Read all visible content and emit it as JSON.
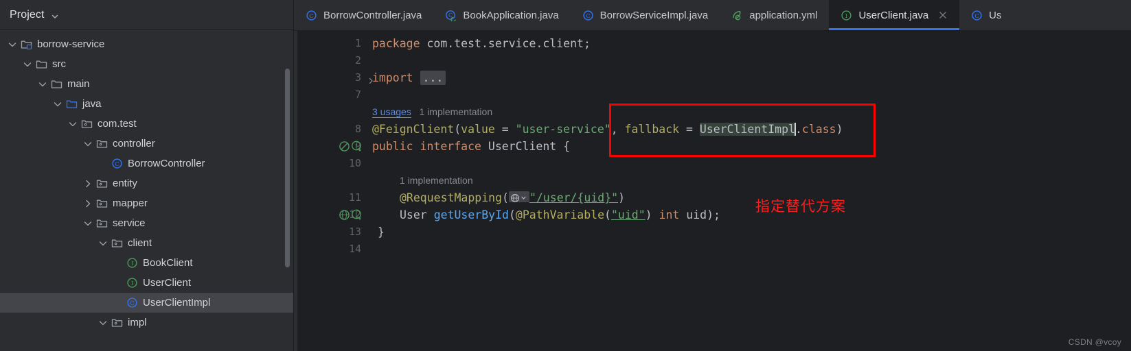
{
  "sidebar": {
    "title": "Project",
    "title_chevron_icon": "chevron-down-icon",
    "tree": [
      {
        "label": "borrow-service",
        "depth": 1,
        "twisty": "expanded",
        "icon": "module-folder-icon",
        "selected": false
      },
      {
        "label": "src",
        "depth": 2,
        "twisty": "expanded",
        "icon": "folder-icon",
        "selected": false
      },
      {
        "label": "main",
        "depth": 3,
        "twisty": "expanded",
        "icon": "folder-icon",
        "selected": false
      },
      {
        "label": "java",
        "depth": 4,
        "twisty": "expanded",
        "icon": "source-folder-icon",
        "selected": false
      },
      {
        "label": "com.test",
        "depth": 5,
        "twisty": "expanded",
        "icon": "package-icon",
        "selected": false
      },
      {
        "label": "controller",
        "depth": 6,
        "twisty": "expanded",
        "icon": "package-icon",
        "selected": false
      },
      {
        "label": "BorrowController",
        "depth": 7,
        "twisty": "none",
        "icon": "class-icon",
        "selected": false
      },
      {
        "label": "entity",
        "depth": 6,
        "twisty": "collapsed",
        "icon": "package-icon",
        "selected": false
      },
      {
        "label": "mapper",
        "depth": 6,
        "twisty": "collapsed",
        "icon": "package-icon",
        "selected": false
      },
      {
        "label": "service",
        "depth": 6,
        "twisty": "expanded",
        "icon": "package-icon",
        "selected": false
      },
      {
        "label": "client",
        "depth": 7,
        "twisty": "expanded",
        "icon": "package-icon",
        "selected": false
      },
      {
        "label": "BookClient",
        "depth": 8,
        "twisty": "none",
        "icon": "interface-icon",
        "selected": false
      },
      {
        "label": "UserClient",
        "depth": 8,
        "twisty": "none",
        "icon": "interface-icon",
        "selected": false
      },
      {
        "label": "UserClientImpl",
        "depth": 8,
        "twisty": "none",
        "icon": "class-icon",
        "selected": true
      },
      {
        "label": "impl",
        "depth": 7,
        "twisty": "expanded",
        "icon": "package-icon",
        "selected": false
      }
    ]
  },
  "tabs": [
    {
      "label": "BorrowController.java",
      "icon": "class-icon",
      "active": false,
      "closable": false
    },
    {
      "label": "BookApplication.java",
      "icon": "spring-class-icon",
      "active": false,
      "closable": false
    },
    {
      "label": "BorrowServiceImpl.java",
      "icon": "class-icon",
      "active": false,
      "closable": false
    },
    {
      "label": "application.yml",
      "icon": "spring-yaml-icon",
      "active": false,
      "closable": false
    },
    {
      "label": "UserClient.java",
      "icon": "interface-icon",
      "active": true,
      "closable": true
    },
    {
      "label": "Us",
      "icon": "class-icon",
      "active": false,
      "closable": false
    }
  ],
  "editor": {
    "filename": "UserClient.java",
    "gutter_numbers": [
      "1",
      "2",
      "3",
      "7",
      "8",
      "9",
      "10",
      "11",
      "12",
      "13",
      "14"
    ],
    "lines": {
      "l1_package_kw": "package",
      "l1_package_name": "com.test.service.client;",
      "l3_import_kw": "import",
      "l3_folded": "...",
      "hint_usages": "3 usages",
      "hint_implementation": "1 implementation",
      "l8_annotation": "@FeignClient",
      "l8_value_key": "value",
      "l8_value_str": "\"user-service\"",
      "l8_fallback_key": "fallback",
      "l8_fallback_val": "UserClientImpl",
      "l8_class_kw": ".class)",
      "l9_public": "public",
      "l9_interface": "interface",
      "l9_name": "UserClient {",
      "hint_method_impl": "1 implementation",
      "l11_annotation": "@RequestMapping",
      "l11_path": "\"/user/{uid}\"",
      "l12_ret_type": "User",
      "l12_method": "getUserById",
      "l12_param_anno": "@PathVariable",
      "l12_param_str": "\"uid\"",
      "l12_param_type": "int",
      "l12_param_name": "uid);",
      "l13_close": "}"
    }
  },
  "annotation": {
    "note_text": "指定替代方案",
    "box_color": "#fe0000",
    "note_color": "#fe1c1c"
  },
  "watermark": {
    "text": "CSDN @vcoy"
  }
}
